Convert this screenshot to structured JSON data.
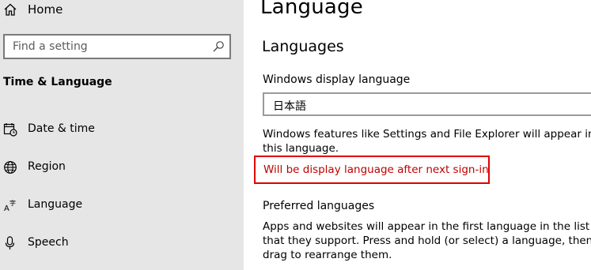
{
  "sidebar": {
    "home_label": "Home",
    "search": {
      "placeholder": "Find a setting"
    },
    "section_title": "Time & Language",
    "items": [
      {
        "label": "Date & time",
        "icon": "calendar-clock-icon"
      },
      {
        "label": "Region",
        "icon": "globe-icon"
      },
      {
        "label": "Language",
        "icon": "language-icon"
      },
      {
        "label": "Speech",
        "icon": "microphone-icon"
      }
    ]
  },
  "main": {
    "title": "Language",
    "languages_heading": "Languages",
    "display_language_label": "Windows display language",
    "display_language_value": "日本語",
    "features_text": "Windows features like Settings and File Explorer will appear in this language.",
    "status_text": "Will be display language after next sign-in",
    "preferred_label": "Preferred languages",
    "apps_text": "Apps and websites will appear in the first language in the list that they support. Press and hold (or select) a language, then drag to rearrange them."
  },
  "colors": {
    "sidebar_bg": "#e6e6e6",
    "status_text": "#c00000",
    "status_border": "#e00000"
  }
}
